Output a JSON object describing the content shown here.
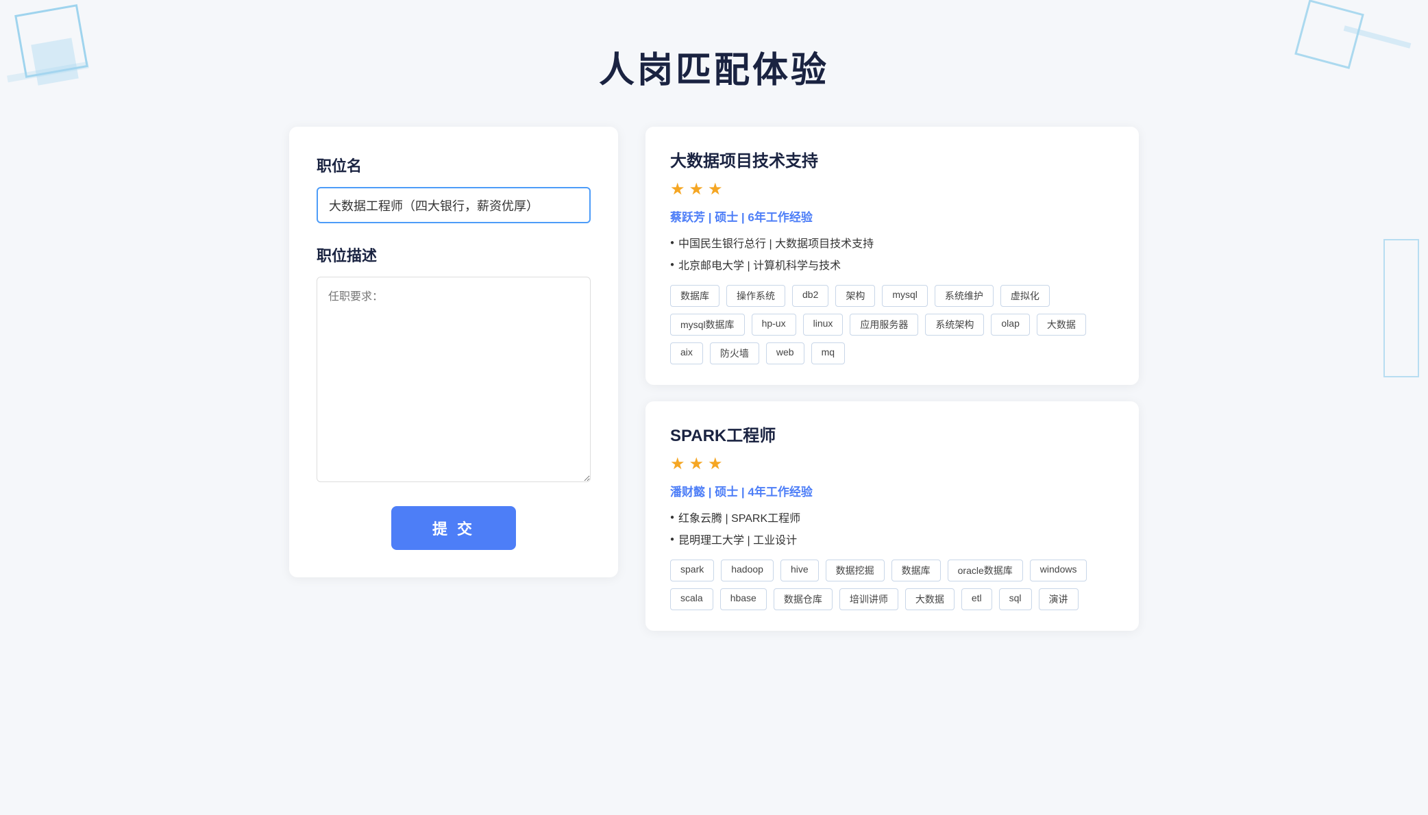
{
  "page": {
    "title": "人岗匹配体验"
  },
  "form": {
    "job_title_label": "职位名",
    "job_title_value": "大数据工程师（四大银行，薪资优厚）",
    "job_desc_label": "职位描述",
    "job_desc_placeholder": "任职要求：",
    "submit_label": "提 交"
  },
  "results": [
    {
      "id": "result-1",
      "job_title": "大数据项目技术支持",
      "stars": 3,
      "candidate_name": "蔡跃芳",
      "candidate_degree": "硕士",
      "candidate_experience": "6年工作经验",
      "details": [
        "中国民生银行总行 | 大数据项目技术支持",
        "北京邮电大学 | 计算机科学与技术"
      ],
      "tags": [
        "数据库",
        "操作系统",
        "db2",
        "架构",
        "mysql",
        "系统维护",
        "虚拟化",
        "mysql数据库",
        "hp-ux",
        "linux",
        "应用服务器",
        "系统架构",
        "olap",
        "大数据",
        "aix",
        "防火墙",
        "web",
        "mq"
      ]
    },
    {
      "id": "result-2",
      "job_title": "SPARK工程师",
      "stars": 3,
      "candidate_name": "潘财懿",
      "candidate_degree": "硕士",
      "candidate_experience": "4年工作经验",
      "details": [
        "红象云腾 | SPARK工程师",
        "昆明理工大学 | 工业设计"
      ],
      "tags": [
        "spark",
        "hadoop",
        "hive",
        "数据挖掘",
        "数据库",
        "oracle数据库",
        "windows",
        "scala",
        "hbase",
        "数据仓库",
        "培训讲师",
        "大数据",
        "etl",
        "sql",
        "演讲"
      ]
    }
  ],
  "colors": {
    "accent": "#4d7ef7",
    "star": "#f5a623",
    "title": "#1a2341",
    "tag_border": "#c8d6e8"
  }
}
